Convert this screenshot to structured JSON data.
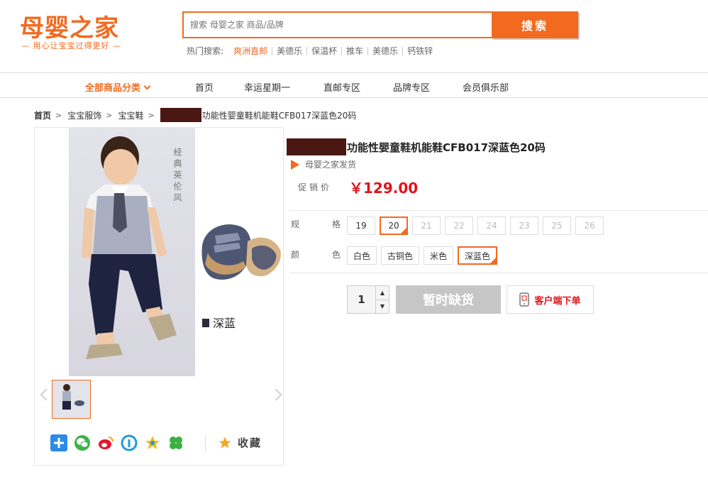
{
  "header": {
    "logo": "母婴之家",
    "slogan": "— 用心让宝宝过得更好 —",
    "search_placeholder": "搜索 母婴之家 商品/品牌",
    "search_button": "搜索",
    "hot_label": "热门搜索:",
    "hot_terms": [
      "爽洲直邮",
      "美德乐",
      "保温杯",
      "推车",
      "美德乐",
      "钙铁锌"
    ]
  },
  "nav": {
    "categories": "全部商品分类",
    "items": [
      "首页",
      "幸运星期一",
      "直邮专区",
      "品牌专区",
      "会员俱乐部"
    ]
  },
  "breadcrumb": [
    "首页",
    "宝宝服饰",
    "宝宝鞋",
    "功能性婴童鞋机能鞋CFB017深蓝色20码"
  ],
  "gallery": {
    "image_text": "经典英伦风",
    "shoe_label": "深蓝",
    "favorite": "收藏"
  },
  "product": {
    "title": "功能性婴童鞋机能鞋CFB017深蓝色20码",
    "shipping": "母婴之家发货",
    "price_label": "促销价",
    "price": "￥129.00",
    "size_label": "规格",
    "sizes": [
      "19",
      "20",
      "21",
      "22",
      "24",
      "23",
      "25",
      "26"
    ],
    "selected_size": "20",
    "color_label": "颜色",
    "colors": [
      "白色",
      "古铜色",
      "米色",
      "深蓝色"
    ],
    "selected_color": "深蓝色",
    "quantity": "1",
    "out_of_stock": "暂时缺货",
    "client_order": "客户端下单"
  },
  "colors": {
    "accent": "#f26a1f",
    "price": "#e4121a",
    "disabled_button": "#c6c6c6"
  }
}
